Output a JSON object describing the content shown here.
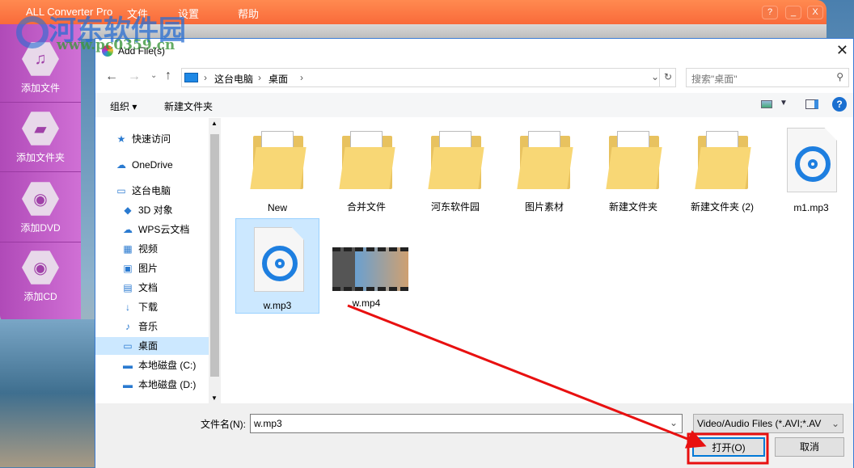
{
  "app": {
    "title": "ALL Converter Pro",
    "menu": [
      "文件",
      "设置",
      "帮助"
    ],
    "window_buttons": [
      "?",
      "_",
      "X"
    ],
    "sidebar": [
      {
        "label": "添加文件",
        "icon": "film-music-icon"
      },
      {
        "label": "添加文件夹",
        "icon": "folder-icon"
      },
      {
        "label": "添加DVD",
        "icon": "dvd-icon"
      },
      {
        "label": "添加CD",
        "icon": "cd-icon"
      }
    ]
  },
  "watermark": {
    "name": "河东软件园",
    "url": "www.pc0359.cn"
  },
  "dialog": {
    "title": "Add File(s)",
    "breadcrumb": [
      "这台电脑",
      "桌面"
    ],
    "search_placeholder": "搜索\"桌面\"",
    "toolbar": {
      "organize": "组织",
      "new_folder": "新建文件夹"
    },
    "nav": [
      {
        "label": "快速访问",
        "icon": "★"
      },
      {
        "label": "OneDrive",
        "icon": "☁"
      },
      {
        "label": "这台电脑",
        "icon": "▭"
      },
      {
        "label": "3D 对象",
        "icon": "◆"
      },
      {
        "label": "WPS云文档",
        "icon": "☁"
      },
      {
        "label": "视频",
        "icon": "▦"
      },
      {
        "label": "图片",
        "icon": "▣"
      },
      {
        "label": "文档",
        "icon": "▤"
      },
      {
        "label": "下载",
        "icon": "↓"
      },
      {
        "label": "音乐",
        "icon": "♪"
      },
      {
        "label": "桌面",
        "icon": "▭",
        "selected": true
      },
      {
        "label": "本地磁盘 (C:)",
        "icon": "▬"
      },
      {
        "label": "本地磁盘 (D:)",
        "icon": "▬"
      }
    ],
    "files": [
      {
        "name": "New",
        "type": "folder"
      },
      {
        "name": "合并文件",
        "type": "folder"
      },
      {
        "name": "河东软件园",
        "type": "folder"
      },
      {
        "name": "图片素材",
        "type": "folder"
      },
      {
        "name": "新建文件夹",
        "type": "folder"
      },
      {
        "name": "新建文件夹 (2)",
        "type": "folder"
      },
      {
        "name": "m1.mp3",
        "type": "audio"
      },
      {
        "name": "w.mp3",
        "type": "audio",
        "selected": true
      },
      {
        "name": "w.mp4",
        "type": "video"
      }
    ],
    "filename_label": "文件名(N):",
    "filename_value": "w.mp3",
    "filter": "Video/Audio Files (*.AVI;*.AV",
    "open": "打开(O)",
    "cancel": "取消"
  },
  "colors": {
    "accent": "#f96a3a",
    "sidebar": "#c060c8",
    "selection": "#cce8ff",
    "annotation": "#e81010"
  }
}
